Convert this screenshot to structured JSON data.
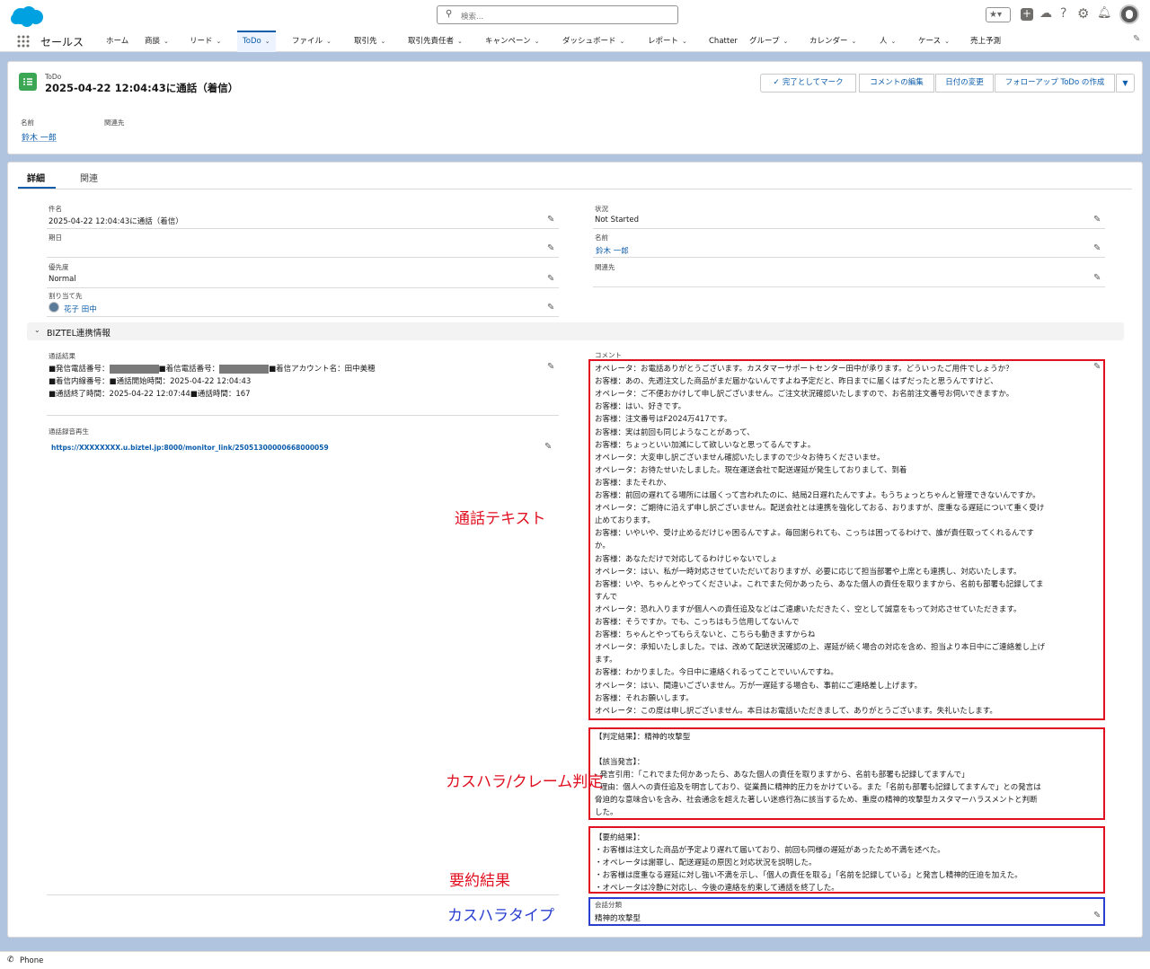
{
  "header": {
    "search_placeholder": "検索...",
    "app_name": "セールス",
    "icons": [
      "favorites-icon",
      "add-icon",
      "trailhead-icon",
      "help-icon",
      "setup-gear-icon",
      "notifications-bell-icon",
      "user-avatar"
    ]
  },
  "nav": {
    "items": [
      {
        "label": "ホーム",
        "chevron": false
      },
      {
        "label": "商談",
        "chevron": true
      },
      {
        "label": "リード",
        "chevron": true
      },
      {
        "label": "ToDo",
        "chevron": true,
        "active": true
      },
      {
        "label": "ファイル",
        "chevron": true
      },
      {
        "label": "取引先",
        "chevron": true
      },
      {
        "label": "取引先責任者",
        "chevron": true
      },
      {
        "label": "キャンペーン",
        "chevron": true
      },
      {
        "label": "ダッシュボード",
        "chevron": true
      },
      {
        "label": "レポート",
        "chevron": true
      },
      {
        "label": "Chatter",
        "chevron": false
      },
      {
        "label": "グループ",
        "chevron": true
      },
      {
        "label": "カレンダー",
        "chevron": true
      },
      {
        "label": "人",
        "chevron": true
      },
      {
        "label": "ケース",
        "chevron": true
      },
      {
        "label": "売上予測",
        "chevron": false
      }
    ]
  },
  "record": {
    "object_label": "ToDo",
    "title": "2025-04-22 12:04:43に通話（着信）",
    "buttons": {
      "mark_complete": "完了としてマーク",
      "edit_comment": "コメントの編集",
      "change_date": "日付の変更",
      "create_followup": "フォローアップ ToDo の作成"
    },
    "highlights": {
      "name_label": "名前",
      "name_value": "鈴木 一郎",
      "related_label": "関連先"
    }
  },
  "tabs": {
    "detail": "詳細",
    "related": "関連"
  },
  "fields": {
    "subject_label": "件名",
    "subject_value": "2025-04-22 12:04:43に通話（着信）",
    "due_label": "期日",
    "priority_label": "優先度",
    "priority_value": "Normal",
    "assigned_label": "割り当て先",
    "assigned_value": "花子 田中",
    "status_label": "状況",
    "status_value": "Not Started",
    "name_label": "名前",
    "name_value": "鈴木 一郎",
    "related_label": "関連先"
  },
  "section": {
    "title": "BIZTEL連携情報",
    "call_result_label": "通話結果",
    "call_result_lines": [
      {
        "a": "■発信電話番号：",
        "b": "■着信電話番号：",
        "c": "■着信アカウント名：田中美穂"
      },
      "■着信内線番号：■通話開始時間：2025-04-22 12:04:43",
      "■通話終了時間：2025-04-22 12:07:44■通話時間：167"
    ],
    "recording_label": "通話録音再生",
    "recording_url": "https://XXXXXXXX.u.biztel.jp:8000/monitor_link/25051300000668000059",
    "comment_label": "コメント",
    "transcript": [
      "オペレータ：お電話ありがとうございます。カスタマーサポートセンター田中が承ります。どういったご用件でしょうか？",
      "お客様：あの、先週注文した商品がまだ届かないんですよね予定だと、昨日までに届くはずだったと思うんですけど、",
      "オペレータ：ご不便おかけして申し訳ございません。ご注文状況確認いたしますので、お名前注文番号お伺いできますか。",
      "お客様：はい、好きです。",
      "お客様：注文番号はF2024万417です。",
      "お客様：実は前回も同じようなことがあって、",
      "お客様：ちょっといい加減にして欲しいなと思ってるんですよ。",
      "オペレータ：大変申し訳ございません確認いたしますので少々お待ちくださいませ。",
      "オペレータ：お待たせいたしました。現在運送会社で配送遅延が発生しておりまして、到着",
      "お客様：またそれか、",
      "お客様：前回の遅れてる場所には届くって言われたのに、結局2日遅れたんですよ。もうちょっとちゃんと管理できないんですか。",
      "オペレータ：ご期待に沿えず申し訳ございません。配送会社とは連携を強化しておる、おりますが、度重なる遅延について重く受け",
      "止めております。",
      "お客様：いやいや、受け止めるだけじゃ困るんですよ。毎回謝られても、こっちは困ってるわけで、誰が責任取ってくれるんです",
      "か。",
      "お客様：あなただけで対応してるわけじゃないでしょ",
      "オペレータ：はい、私が一時対応させていただいておりますが、必要に応じて担当部署や上席とも連携し、対応いたします。",
      "お客様：いや、ちゃんとやってくださいよ。これでまた何かあったら、あなた個人の責任を取りますから、名前も部署も記録してま",
      "すんで",
      "オペレータ：恐れ入りますが個人への責任追及などはご遠慮いただきたく、空として誠意をもって対応させていただきます。",
      "お客様：そうですか。でも、こっちはもう信用してないんで",
      "お客様：ちゃんとやってもらえないと、こちらも動きますからね",
      "オペレータ：承知いたしました。では、改めて配送状況確認の上、遅延が続く場合の対応を含め、担当より本日中にご連絡差し上げ",
      "ます。",
      "お客様：わかりました。今日中に連絡くれるってことでいいんですね。",
      "オペレータ：はい、間違いございません。万が一遅延する場合も、事前にご連絡差し上げます。",
      "お客様：それお願いします。",
      "オペレータ：この度は申し訳ございません。本日はお電話いただきまして、ありがとうございます。失礼いたします。"
    ],
    "judgement": [
      "【判定結果】：精神的攻撃型",
      "",
      "【該当発言】：",
      "- 発言引用：「これでまた何かあったら、あなた個人の責任を取りますから、名前も部署も記録してますんで」",
      "- 理由：個人への責任追及を明言しており、従業員に精神的圧力をかけている。また「名前も部署も記録してますんで」との発言は",
      "脅迫的な意味合いを含み、社会通念を超えた著しい迷惑行為に該当するため、重度の精神的攻撃型カスタマーハラスメントと判断",
      "した。"
    ],
    "summary": [
      "【要約結果】：",
      "・お客様は注文した商品が予定より遅れて届いており、前回も同様の遅延があったため不満を述べた。",
      "・オペレータは謝罪し、配送遅延の原因と対応状況を説明した。",
      "・お客様は度重なる遅延に対し強い不満を示し、「個人の責任を取る」「名前を記録している」と発言し精神的圧迫を加えた。",
      "・オペレータは冷静に対応し、今後の連絡を約束して通話を終了した。"
    ],
    "category_label": "会話分類",
    "category_value": "精神的攻撃型"
  },
  "annotations": {
    "transcript": "通話テキスト",
    "judgement": "カスハラ/クレーム判定",
    "summary": "要約結果",
    "type": "カスハラタイプ",
    "red": "#e01020",
    "blue": "#2a3fd0"
  },
  "footer": {
    "phone_label": "Phone"
  },
  "colors": {
    "brand": "#0b5cab",
    "cloud": "#00a1e0",
    "todo_icon": "#3ba755"
  }
}
